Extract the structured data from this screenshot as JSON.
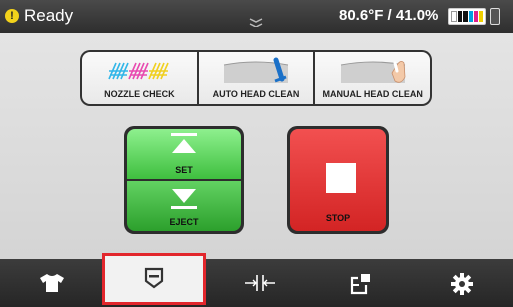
{
  "status": {
    "state": "Ready",
    "temperature_humidity": "80.6°F / 41.0%",
    "icons": [
      "warning-icon",
      "drag-handle-icon",
      "ink-level-icon",
      "waste-bin-icon"
    ],
    "ink_colors": [
      "#ffffff",
      "#111111",
      "#00a0e0",
      "#e0208a",
      "#f0d000"
    ]
  },
  "maintenance": {
    "nozzle_check": "NOZZLE CHECK",
    "auto_head_clean": "AUTO HEAD CLEAN",
    "manual_head_clean": "MANUAL HEAD CLEAN"
  },
  "platen": {
    "set_label": "SET",
    "eject_label": "EJECT"
  },
  "stop_label": "STOP",
  "nav": {
    "items": [
      "tshirt-icon",
      "print-head-icon",
      "adjust-icon",
      "transfer-icon",
      "gear-icon"
    ],
    "selected_index": 1
  },
  "colors": {
    "accent_green": "#4fcf4f",
    "stop_red": "#e23a3a",
    "selection_red": "#e2262c",
    "warning_yellow": "#f2d21b"
  }
}
